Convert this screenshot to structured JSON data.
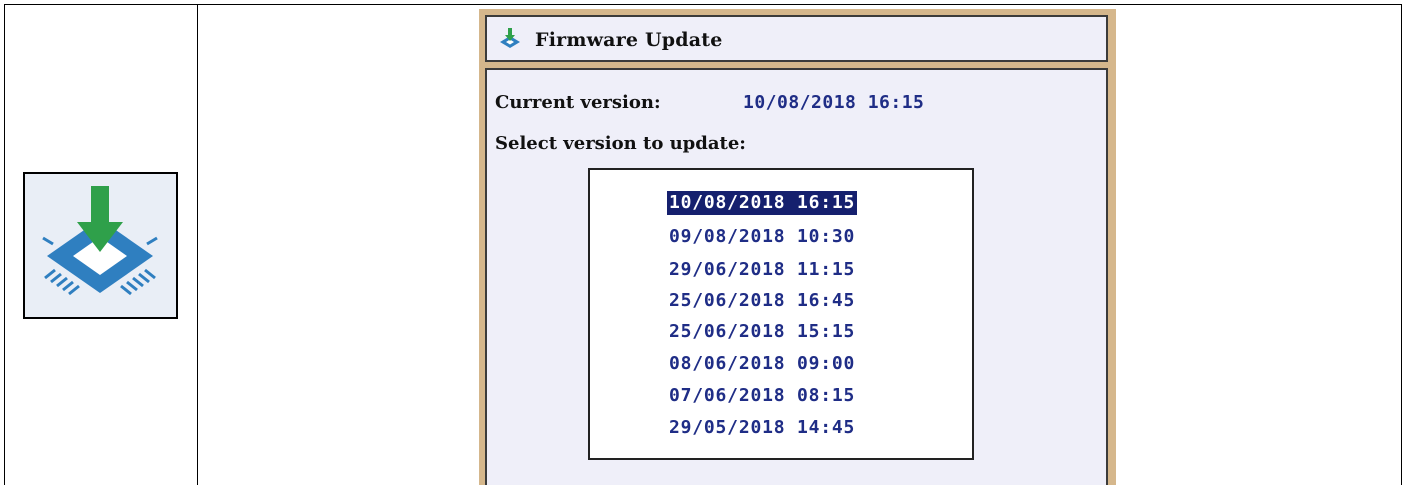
{
  "dialog": {
    "title": "Firmware Update",
    "current_version_label": "Current version:",
    "current_version_value": "10/08/2018 16:15",
    "select_label": "Select version to update:"
  },
  "versions": [
    {
      "label": "10/08/2018 16:15",
      "selected": true
    },
    {
      "label": "09/08/2018 10:30",
      "selected": false
    },
    {
      "label": "29/06/2018 11:15",
      "selected": false
    },
    {
      "label": "25/06/2018 16:45",
      "selected": false
    },
    {
      "label": "25/06/2018 15:15",
      "selected": false
    },
    {
      "label": "08/06/2018 09:00",
      "selected": false
    },
    {
      "label": "07/06/2018 08:15",
      "selected": false
    },
    {
      "label": "29/05/2018 14:45",
      "selected": false
    }
  ],
  "icons": {
    "left": "firmware-download-chip-icon",
    "title": "firmware-download-chip-icon"
  },
  "colors": {
    "frame": "#d5b78c",
    "panel_bg": "#efeff9",
    "text_value": "#1f2d86",
    "selection_bg": "#15206e",
    "arrow_green": "#2fa04a",
    "chip_blue": "#2f7fc0"
  }
}
